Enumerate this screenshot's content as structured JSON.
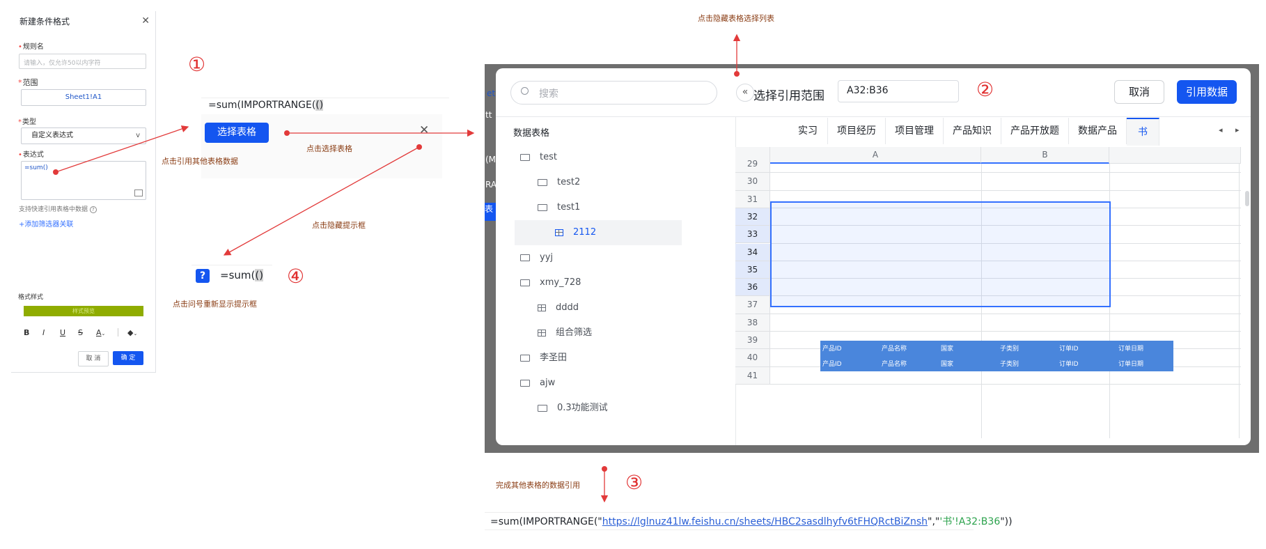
{
  "left_panel": {
    "title": "新建条件格式",
    "rule_name_label": "规则名",
    "rule_name_placeholder": "请输入，仅允许50以内字符",
    "range_label": "范围",
    "range_value": "Sheet1!A1",
    "type_label": "类型",
    "type_value": "自定义表达式",
    "expr_label": "表达式",
    "expr_value": "=sum()",
    "hint": "支持快速引用表格中数据",
    "add_filter": "+添加筛选器关联",
    "format_label": "格式样式",
    "preview": "样式预览",
    "cancel": "取 消",
    "confirm": "确 定",
    "preview_color": "#8fac00"
  },
  "step1": {
    "num": "①",
    "formula_pre": "=sum(IMPORTRANGE(",
    "formula_hl": "()",
    "button": "选择表格",
    "anno_ref": "点击引用其他表格数据",
    "anno_select": "点击选择表格",
    "anno_hide": "点击隐藏提示框"
  },
  "top_anno": "点击隐藏表格选择列表",
  "step2": {
    "num": "②",
    "search_placeholder": "搜索",
    "title": "选择引用范围",
    "range": "A32:B36",
    "cancel": "取消",
    "submit": "引用数据",
    "tree_header": "数据表格",
    "tree": [
      {
        "label": "test",
        "level": 0,
        "kind": "folder"
      },
      {
        "label": "test2",
        "level": 1,
        "kind": "folder"
      },
      {
        "label": "test1",
        "level": 1,
        "kind": "folder"
      },
      {
        "label": "2112",
        "level": 2,
        "kind": "sheet",
        "selected": true
      },
      {
        "label": "yyj",
        "level": 0,
        "kind": "folder"
      },
      {
        "label": "xmy_728",
        "level": 0,
        "kind": "folder"
      },
      {
        "label": "dddd",
        "level": 1,
        "kind": "sheet"
      },
      {
        "label": "组合筛选",
        "level": 1,
        "kind": "sheet"
      },
      {
        "label": "李圣田",
        "level": 0,
        "kind": "folder"
      },
      {
        "label": "ajw",
        "level": 0,
        "kind": "folder"
      },
      {
        "label": "0.3功能测试",
        "level": 1,
        "kind": "folder"
      }
    ],
    "tabs": [
      "实习",
      "项目经历",
      "项目管理",
      "产品知识",
      "产品开放题",
      "数据产品",
      "书"
    ],
    "columns": [
      "A",
      "B"
    ],
    "rows": [
      "29",
      "30",
      "31",
      "32",
      "33",
      "34",
      "35",
      "36",
      "37",
      "38",
      "39",
      "40",
      "41"
    ],
    "mini_headers": [
      "产品ID",
      "产品名称",
      "国家",
      "子类别",
      "订单ID",
      "订单日期"
    ]
  },
  "step3": {
    "num": "③",
    "anno": "完成其他表格的数据引用",
    "formula_pre": "=sum(",
    "formula_fn": "IMPORTRANGE(\"",
    "formula_url": "https://lglnuz41lw.feishu.cn/sheets/HBC2sasdlhyfv6tFHQRctBiZnsh",
    "formula_sep": "\",\"",
    "formula_ref": "'书'!A32:B36",
    "formula_end": "\"))"
  },
  "step4": {
    "num": "④",
    "q": "?",
    "formula": "=sum(",
    "formula_hl": "()",
    "anno": "点击问号重新显示提示框"
  },
  "colors": {
    "accent": "#1456f0",
    "annotation_red": "#e23a3a",
    "annotation_text": "#8a3d14",
    "selection_border": "#3370ff",
    "selection_fill": "#eef3fd",
    "mini_table": "#4a86dc"
  }
}
